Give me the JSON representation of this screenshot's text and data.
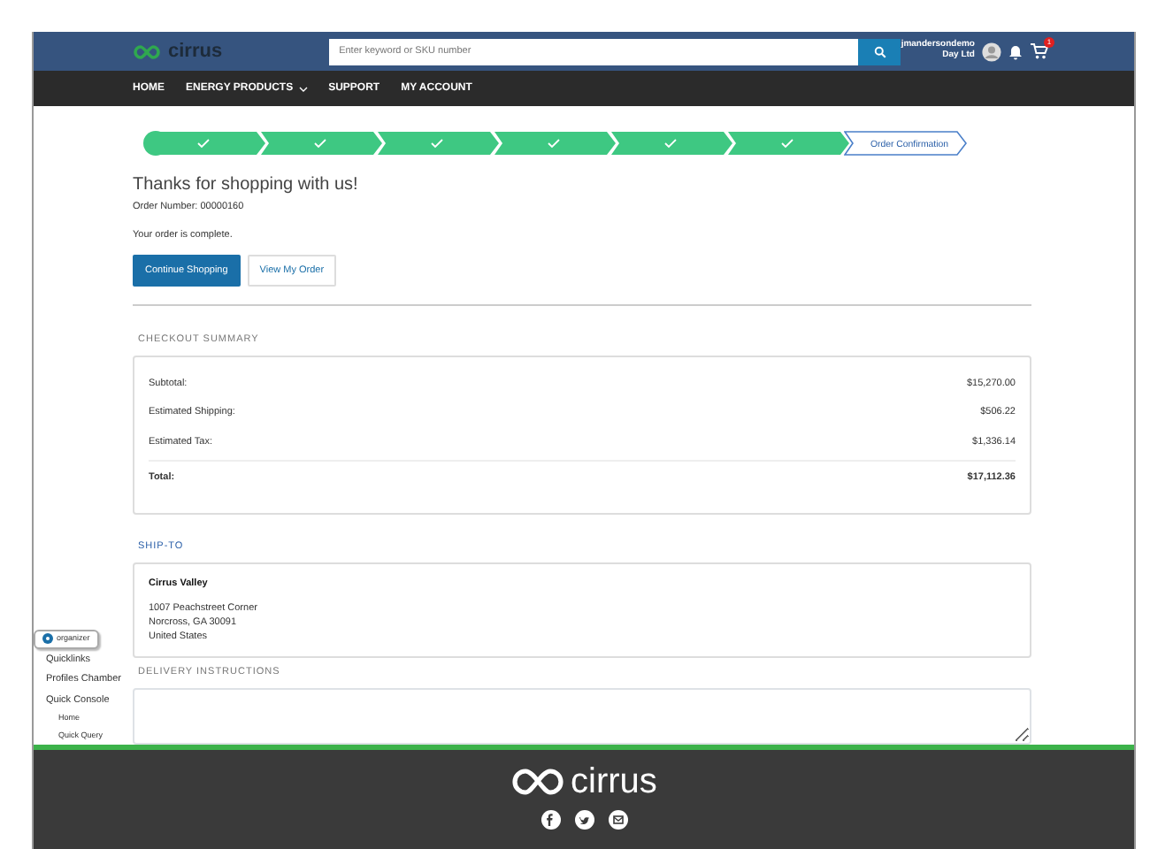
{
  "header": {
    "logo": "cirrus",
    "search": {
      "placeholder": "Enter keyword or SKU number"
    },
    "user": {
      "name": "jmandersondemo",
      "company": "Day Ltd"
    },
    "cart_count": "1"
  },
  "nav": [
    {
      "label": "HOME",
      "dropdown": false
    },
    {
      "label": "ENERGY PRODUCTS",
      "dropdown": true
    },
    {
      "label": "SUPPORT",
      "dropdown": false
    },
    {
      "label": "MY ACCOUNT",
      "dropdown": false
    }
  ],
  "steps": [
    {
      "completed": true
    },
    {
      "completed": true
    },
    {
      "completed": true
    },
    {
      "completed": true
    },
    {
      "completed": true
    },
    {
      "completed": true
    },
    {
      "label": "Order Confirmation",
      "completed": false
    }
  ],
  "confirmation": {
    "title": "Thanks for shopping with us!",
    "order_number": "Order Number: 00000160",
    "message": "Your order is complete.",
    "buttons": [
      {
        "label": "Continue Shopping",
        "primary": true
      },
      {
        "label": "View My Order",
        "primary": false
      }
    ]
  },
  "checkout_summary": {
    "heading": "CHECKOUT SUMMARY",
    "rows": [
      {
        "label": "Subtotal:",
        "value": "$15,270.00",
        "total": false
      },
      {
        "label": "Estimated Shipping:",
        "value": "$506.22",
        "total": false
      },
      {
        "label": "Estimated Tax:",
        "value": "$1,336.14",
        "total": false
      },
      {
        "label": "Total:",
        "value": "$17,112.36",
        "total": true
      }
    ]
  },
  "ship_to": {
    "heading": "SHIP-TO",
    "name": "Cirrus Valley",
    "lines": [
      "1007 Peachstreet Corner",
      "Norcross, GA 30091",
      "United States"
    ]
  },
  "delivery_instructions": {
    "heading": "DELIVERY INSTRUCTIONS"
  },
  "organizer": {
    "label": "organizer",
    "items": [
      {
        "label": "Quicklinks"
      },
      {
        "label": "Profiles Chamber"
      },
      {
        "label": "Quick Console",
        "children": [
          {
            "label": "Home"
          },
          {
            "label": "Quick Query"
          }
        ]
      }
    ]
  },
  "footer": {
    "logo": "cirrus",
    "social": [
      {
        "kind": "facebook"
      },
      {
        "kind": "twitter"
      },
      {
        "kind": "email"
      }
    ]
  }
}
